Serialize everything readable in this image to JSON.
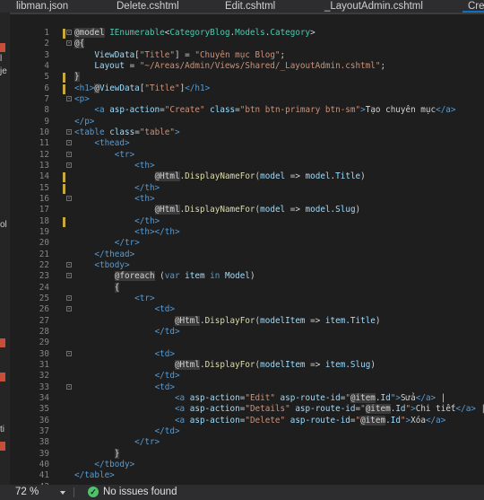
{
  "tabs": [
    {
      "label": "libman.json",
      "active": false
    },
    {
      "label": "Delete.cshtml",
      "active": false
    },
    {
      "label": "Edit.cshtml",
      "active": false
    },
    {
      "label": "_LayoutAdmin.cshtml",
      "active": false
    },
    {
      "label": "Cre",
      "active": true
    }
  ],
  "left_panel": {
    "fragments": [
      "l",
      "je",
      "ol",
      "ti"
    ]
  },
  "editor": {
    "lines": [
      {
        "n": "1",
        "changed": true,
        "fold": "-",
        "tokens": [
          [
            "rz",
            "@model"
          ],
          [
            "p",
            " "
          ],
          [
            "ty",
            "IEnumerable"
          ],
          [
            "p",
            "<"
          ],
          [
            "ty",
            "CategoryBlog"
          ],
          [
            "p",
            "."
          ],
          [
            "ty",
            "Models"
          ],
          [
            "p",
            "."
          ],
          [
            "ty",
            "Category"
          ],
          [
            "p",
            ">"
          ]
        ]
      },
      {
        "n": "2",
        "changed": false,
        "fold": "-",
        "tokens": [
          [
            "rz",
            "@{"
          ]
        ]
      },
      {
        "n": "3",
        "changed": false,
        "fold": "",
        "tokens": [
          [
            "p",
            "    "
          ],
          [
            "v",
            "ViewData"
          ],
          [
            "p",
            "["
          ],
          [
            "s",
            "\"Title\""
          ],
          [
            "p",
            "] = "
          ],
          [
            "s",
            "\"Chuyên mục Blog\""
          ],
          [
            "p",
            ";"
          ]
        ]
      },
      {
        "n": "4",
        "changed": false,
        "fold": "",
        "tokens": [
          [
            "p",
            "    "
          ],
          [
            "v",
            "Layout"
          ],
          [
            "p",
            " = "
          ],
          [
            "s",
            "\"~/Areas/Admin/Views/Shared/_LayoutAdmin.cshtml\""
          ],
          [
            "p",
            ";"
          ]
        ]
      },
      {
        "n": "5",
        "changed": true,
        "fold": "",
        "tokens": [
          [
            "rz",
            "}"
          ]
        ]
      },
      {
        "n": "6",
        "changed": true,
        "fold": "",
        "tokens": [
          [
            "p",
            ""
          ],
          [
            "t",
            "<h1>"
          ],
          [
            "rz",
            "@"
          ],
          [
            "v",
            "ViewData"
          ],
          [
            "p",
            "["
          ],
          [
            "s",
            "\"Title\""
          ],
          [
            "p",
            "]"
          ],
          [
            "t",
            "</h1>"
          ]
        ]
      },
      {
        "n": "7",
        "changed": false,
        "fold": "-",
        "tokens": [
          [
            "t",
            "<p>"
          ]
        ]
      },
      {
        "n": "8",
        "changed": false,
        "fold": "",
        "tokens": [
          [
            "p",
            "    "
          ],
          [
            "t",
            "<a "
          ],
          [
            "a",
            "asp-action"
          ],
          [
            "p",
            "="
          ],
          [
            "s",
            "\"Create\""
          ],
          [
            "a",
            " class"
          ],
          [
            "p",
            "="
          ],
          [
            "s",
            "\"btn btn-primary btn-sm\""
          ],
          [
            "t",
            ">"
          ],
          [
            "txt",
            "Tạo chuyên mục"
          ],
          [
            "t",
            "</a>"
          ]
        ]
      },
      {
        "n": "9",
        "changed": false,
        "fold": "",
        "tokens": [
          [
            "t",
            "</p>"
          ]
        ]
      },
      {
        "n": "10",
        "changed": false,
        "fold": "-",
        "tokens": [
          [
            "t",
            "<table "
          ],
          [
            "a",
            "class"
          ],
          [
            "p",
            "="
          ],
          [
            "s",
            "\"table\""
          ],
          [
            "t",
            ">"
          ]
        ]
      },
      {
        "n": "11",
        "changed": false,
        "fold": "-",
        "tokens": [
          [
            "p",
            "    "
          ],
          [
            "t",
            "<thead>"
          ]
        ]
      },
      {
        "n": "12",
        "changed": false,
        "fold": "-",
        "tokens": [
          [
            "p",
            "        "
          ],
          [
            "t",
            "<tr>"
          ]
        ]
      },
      {
        "n": "13",
        "changed": false,
        "fold": "-",
        "tokens": [
          [
            "p",
            "            "
          ],
          [
            "t",
            "<th>"
          ]
        ]
      },
      {
        "n": "14",
        "changed": true,
        "fold": "",
        "tokens": [
          [
            "p",
            "                "
          ],
          [
            "rz",
            "@Html"
          ],
          [
            "p",
            "."
          ],
          [
            "m",
            "DisplayNameFor"
          ],
          [
            "p",
            "("
          ],
          [
            "v",
            "model"
          ],
          [
            "p",
            " => "
          ],
          [
            "v",
            "model"
          ],
          [
            "p",
            "."
          ],
          [
            "v",
            "Title"
          ],
          [
            "p",
            ")"
          ]
        ]
      },
      {
        "n": "15",
        "changed": true,
        "fold": "",
        "tokens": [
          [
            "p",
            "            "
          ],
          [
            "t",
            "</th>"
          ]
        ]
      },
      {
        "n": "16",
        "changed": false,
        "fold": "-",
        "tokens": [
          [
            "p",
            "            "
          ],
          [
            "t",
            "<th>"
          ]
        ]
      },
      {
        "n": "17",
        "changed": false,
        "fold": "",
        "tokens": [
          [
            "p",
            "                "
          ],
          [
            "rz",
            "@Html"
          ],
          [
            "p",
            "."
          ],
          [
            "m",
            "DisplayNameFor"
          ],
          [
            "p",
            "("
          ],
          [
            "v",
            "model"
          ],
          [
            "p",
            " => "
          ],
          [
            "v",
            "model"
          ],
          [
            "p",
            "."
          ],
          [
            "v",
            "Slug"
          ],
          [
            "p",
            ")"
          ]
        ]
      },
      {
        "n": "18",
        "changed": true,
        "fold": "",
        "tokens": [
          [
            "p",
            "            "
          ],
          [
            "t",
            "</th>"
          ]
        ]
      },
      {
        "n": "19",
        "changed": false,
        "fold": "",
        "tokens": [
          [
            "p",
            "            "
          ],
          [
            "t",
            "<th></th>"
          ]
        ]
      },
      {
        "n": "20",
        "changed": false,
        "fold": "",
        "tokens": [
          [
            "p",
            "        "
          ],
          [
            "t",
            "</tr>"
          ]
        ]
      },
      {
        "n": "21",
        "changed": false,
        "fold": "",
        "tokens": [
          [
            "p",
            "    "
          ],
          [
            "t",
            "</thead>"
          ]
        ]
      },
      {
        "n": "22",
        "changed": false,
        "fold": "-",
        "tokens": [
          [
            "p",
            "    "
          ],
          [
            "t",
            "<tbody>"
          ]
        ]
      },
      {
        "n": "23",
        "changed": false,
        "fold": "-",
        "tokens": [
          [
            "p",
            "        "
          ],
          [
            "rz",
            "@foreach"
          ],
          [
            "p",
            " ("
          ],
          [
            "k",
            "var"
          ],
          [
            "p",
            " "
          ],
          [
            "v",
            "item"
          ],
          [
            "p",
            " "
          ],
          [
            "k",
            "in"
          ],
          [
            "p",
            " "
          ],
          [
            "v",
            "Model"
          ],
          [
            "p",
            ")"
          ]
        ]
      },
      {
        "n": "24",
        "changed": false,
        "fold": "",
        "tokens": [
          [
            "p",
            "        "
          ],
          [
            "rz",
            "{"
          ]
        ]
      },
      {
        "n": "25",
        "changed": false,
        "fold": "-",
        "tokens": [
          [
            "p",
            "            "
          ],
          [
            "t",
            "<tr>"
          ]
        ]
      },
      {
        "n": "26",
        "changed": false,
        "fold": "-",
        "tokens": [
          [
            "p",
            "                "
          ],
          [
            "t",
            "<td>"
          ]
        ]
      },
      {
        "n": "27",
        "changed": false,
        "fold": "",
        "tokens": [
          [
            "p",
            "                    "
          ],
          [
            "rz",
            "@Html"
          ],
          [
            "p",
            "."
          ],
          [
            "m",
            "DisplayFor"
          ],
          [
            "p",
            "("
          ],
          [
            "v",
            "modelItem"
          ],
          [
            "p",
            " => "
          ],
          [
            "v",
            "item"
          ],
          [
            "p",
            "."
          ],
          [
            "v",
            "Title"
          ],
          [
            "p",
            ")"
          ]
        ]
      },
      {
        "n": "28",
        "changed": false,
        "fold": "",
        "tokens": [
          [
            "p",
            "                "
          ],
          [
            "t",
            "</td>"
          ]
        ]
      },
      {
        "n": "29",
        "changed": false,
        "fold": "",
        "tokens": []
      },
      {
        "n": "30",
        "changed": false,
        "fold": "-",
        "tokens": [
          [
            "p",
            "                "
          ],
          [
            "t",
            "<td>"
          ]
        ]
      },
      {
        "n": "31",
        "changed": false,
        "fold": "",
        "tokens": [
          [
            "p",
            "                    "
          ],
          [
            "rz",
            "@Html"
          ],
          [
            "p",
            "."
          ],
          [
            "m",
            "DisplayFor"
          ],
          [
            "p",
            "("
          ],
          [
            "v",
            "modelItem"
          ],
          [
            "p",
            " => "
          ],
          [
            "v",
            "item"
          ],
          [
            "p",
            "."
          ],
          [
            "v",
            "Slug"
          ],
          [
            "p",
            ")"
          ]
        ]
      },
      {
        "n": "32",
        "changed": false,
        "fold": "",
        "tokens": [
          [
            "p",
            "                "
          ],
          [
            "t",
            "</td>"
          ]
        ]
      },
      {
        "n": "33",
        "changed": false,
        "fold": "-",
        "tokens": [
          [
            "p",
            "                "
          ],
          [
            "t",
            "<td>"
          ]
        ]
      },
      {
        "n": "34",
        "changed": false,
        "fold": "",
        "tokens": [
          [
            "p",
            "                    "
          ],
          [
            "t",
            "<a "
          ],
          [
            "a",
            "asp-action"
          ],
          [
            "p",
            "="
          ],
          [
            "s",
            "\"Edit\""
          ],
          [
            "a",
            " asp-route-id"
          ],
          [
            "p",
            "="
          ],
          [
            "s",
            "\""
          ],
          [
            "rz",
            "@item"
          ],
          [
            "p",
            "."
          ],
          [
            "v",
            "Id"
          ],
          [
            "s",
            "\""
          ],
          [
            "t",
            ">"
          ],
          [
            "txt",
            "Sửa"
          ],
          [
            "t",
            "</a>"
          ],
          [
            "p",
            " |"
          ]
        ]
      },
      {
        "n": "35",
        "changed": false,
        "fold": "",
        "tokens": [
          [
            "p",
            "                    "
          ],
          [
            "t",
            "<a "
          ],
          [
            "a",
            "asp-action"
          ],
          [
            "p",
            "="
          ],
          [
            "s",
            "\"Details\""
          ],
          [
            "a",
            " asp-route-id"
          ],
          [
            "p",
            "="
          ],
          [
            "s",
            "\""
          ],
          [
            "rz",
            "@item"
          ],
          [
            "p",
            "."
          ],
          [
            "v",
            "Id"
          ],
          [
            "s",
            "\""
          ],
          [
            "t",
            ">"
          ],
          [
            "txt",
            "Chi tiết"
          ],
          [
            "t",
            "</a>"
          ],
          [
            "p",
            " |"
          ]
        ]
      },
      {
        "n": "36",
        "changed": false,
        "fold": "",
        "tokens": [
          [
            "p",
            "                    "
          ],
          [
            "t",
            "<a "
          ],
          [
            "a",
            "asp-action"
          ],
          [
            "p",
            "="
          ],
          [
            "s",
            "\"Delete\""
          ],
          [
            "a",
            " asp-route-id"
          ],
          [
            "p",
            "="
          ],
          [
            "s",
            "\""
          ],
          [
            "rz",
            "@item"
          ],
          [
            "p",
            "."
          ],
          [
            "v",
            "Id"
          ],
          [
            "s",
            "\""
          ],
          [
            "t",
            ">"
          ],
          [
            "txt",
            "Xóa"
          ],
          [
            "t",
            "</a>"
          ]
        ]
      },
      {
        "n": "37",
        "changed": false,
        "fold": "",
        "tokens": [
          [
            "p",
            "                "
          ],
          [
            "t",
            "</td>"
          ]
        ]
      },
      {
        "n": "38",
        "changed": false,
        "fold": "",
        "tokens": [
          [
            "p",
            "            "
          ],
          [
            "t",
            "</tr>"
          ]
        ]
      },
      {
        "n": "39",
        "changed": false,
        "fold": "",
        "tokens": [
          [
            "p",
            "        "
          ],
          [
            "rz",
            "}"
          ]
        ]
      },
      {
        "n": "40",
        "changed": false,
        "fold": "",
        "tokens": [
          [
            "p",
            "    "
          ],
          [
            "t",
            "</tbody>"
          ]
        ]
      },
      {
        "n": "41",
        "changed": false,
        "fold": "",
        "tokens": [
          [
            "t",
            "</table>"
          ]
        ]
      },
      {
        "n": "42",
        "changed": false,
        "fold": "",
        "tokens": []
      }
    ]
  },
  "status": {
    "zoom": "72 %",
    "issues": "No issues found"
  }
}
